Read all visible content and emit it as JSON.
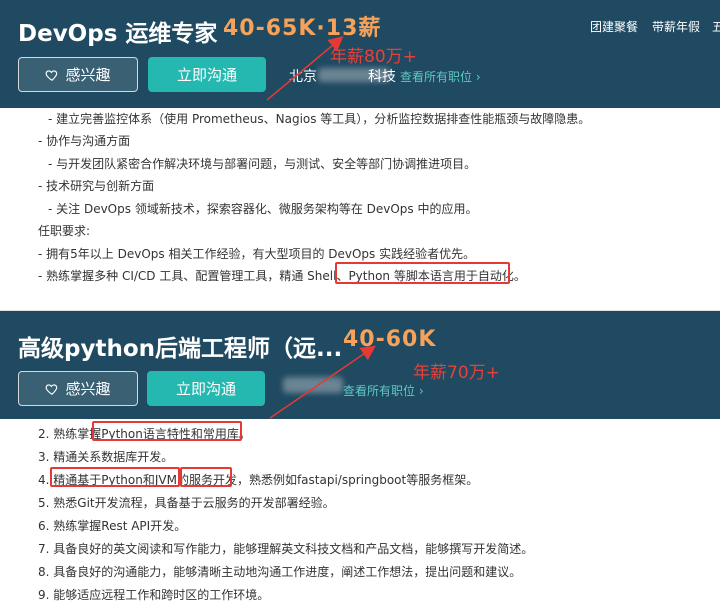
{
  "card1": {
    "title": "DevOps 运维专家",
    "salary": "40-65K·13薪",
    "annual_note": "年薪80万+",
    "like_label": "感兴趣",
    "chat_label": "立即沟通",
    "company_prefix": "北京",
    "company_suffix": "科技",
    "view_all": "查看所有职位",
    "top_links": [
      "团建聚餐",
      "带薪年假",
      "五"
    ],
    "lines": [
      "- 建立完善监控体系（使用 Prometheus、Nagios 等工具），分析监控数据排查性能瓶颈与故障隐患。",
      "- 协作与沟通方面",
      "- 与开发团队紧密合作解决环境与部署问题，与测试、安全等部门协调推进项目。",
      "- 技术研究与创新方面",
      "- 关注 DevOps 领域新技术，探索容器化、微服务架构等在 DevOps 中的应用。",
      "任职要求:",
      "- 拥有5年以上 DevOps 相关工作经验，有大型项目的 DevOps 实践经验者优先。",
      "- 熟练掌握多种 CI/CD 工具、配置管理工具，精通 Shell、Python 等脚本语言用于自动化。"
    ]
  },
  "card2": {
    "title": "高级python后端工程师（远...",
    "salary": "40-60K",
    "annual_note": "年薪70万+",
    "like_label": "感兴趣",
    "chat_label": "立即沟通",
    "view_all": "查看所有职位",
    "lines": [
      "2. 熟练掌握Python语言特性和常用库。",
      "3. 精通关系数据库开发。",
      "4. 精通基于Python和JVM的服务开发，熟悉例如fastapi/springboot等服务框架。",
      "5. 熟悉Git开发流程，具备基于云服务的开发部署经验。",
      "6. 熟练掌握Rest API开发。",
      "7. 具备良好的英文阅读和写作能力，能够理解英文科技文档和产品文档，能够撰写开发简述。",
      "8. 具备良好的沟通能力，能够清晰主动地沟通工作进度，阐述工作想法，提出问题和建议。",
      "9. 能够适应远程工作和跨时区的工作环境。"
    ]
  },
  "colors": {
    "header_bg": "#1f4a61",
    "accent_teal": "#24b8b0",
    "salary_orange": "#f7a25a",
    "annotation_red": "#e53935"
  }
}
